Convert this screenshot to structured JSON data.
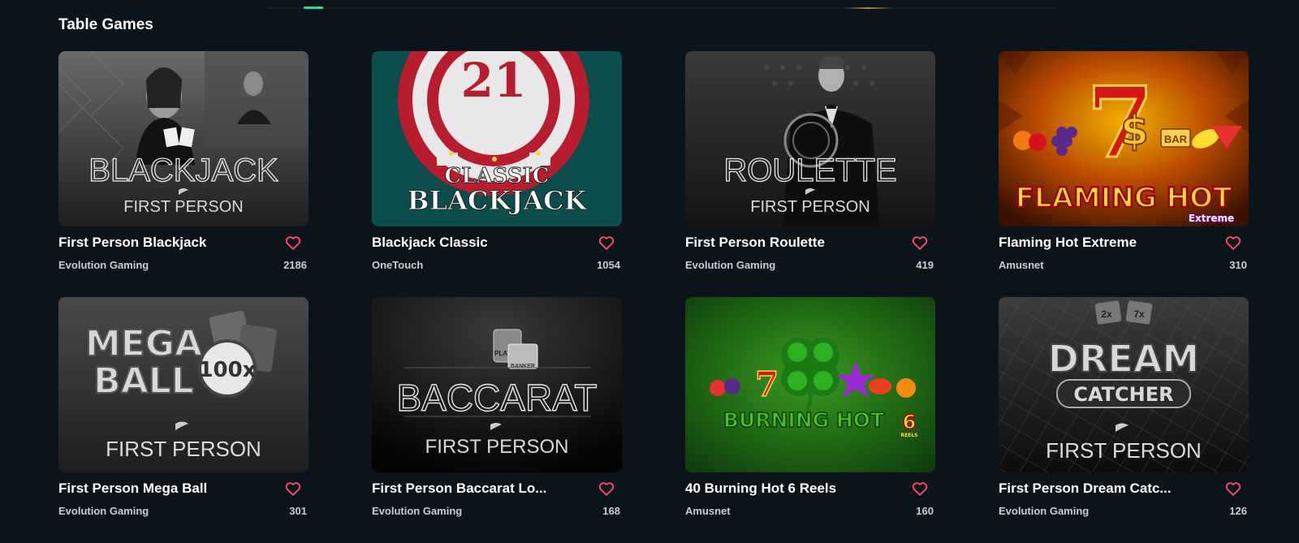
{
  "section": {
    "title": "Table Games"
  },
  "games": [
    {
      "title": "First Person Blackjack",
      "provider": "Evolution Gaming",
      "count": "2186",
      "art_main": "BLACKJACK",
      "art_sub": "FIRST PERSON"
    },
    {
      "title": "Blackjack Classic",
      "provider": "OneTouch",
      "count": "1054",
      "art_main": "21",
      "art_line1": "CLASSIC",
      "art_line2": "BLACKJACK"
    },
    {
      "title": "First Person Roulette",
      "provider": "Evolution Gaming",
      "count": "419",
      "art_main": "ROULETTE",
      "art_sub": "FIRST PERSON"
    },
    {
      "title": "Flaming Hot Extreme",
      "provider": "Amusnet",
      "count": "310",
      "art_main": "FLAMING HOT",
      "art_sub": "Extreme",
      "art_seven": "7",
      "art_bar": "BAR"
    },
    {
      "title": "First Person Mega Ball",
      "provider": "Evolution Gaming",
      "count": "301",
      "art_line1": "MEGA",
      "art_line2": "BALL",
      "art_badge": "100x",
      "art_sub": "FIRST PERSON"
    },
    {
      "title": "First Person Baccarat Lo...",
      "provider": "Evolution Gaming",
      "count": "168",
      "art_main": "BACCARAT",
      "art_sub": "FIRST PERSON",
      "art_player": "PLAYER",
      "art_banker": "BANKER"
    },
    {
      "title": "40 Burning Hot 6 Reels",
      "provider": "Amusnet",
      "count": "160",
      "art_main": "BURNING HOT",
      "art_six": "6",
      "art_reels": "REELS"
    },
    {
      "title": "First Person Dream Catc...",
      "provider": "Evolution Gaming",
      "count": "126",
      "art_line1": "DREAM",
      "art_line2": "CATCHER",
      "art_sub": "FIRST PERSON",
      "art_m1": "2x",
      "art_m2": "7x"
    }
  ],
  "colors": {
    "accent": "#27e08c",
    "heart": "#ff4f6a",
    "background": "#0c141b"
  },
  "icons": {
    "favorite": "heart-outline-icon"
  }
}
